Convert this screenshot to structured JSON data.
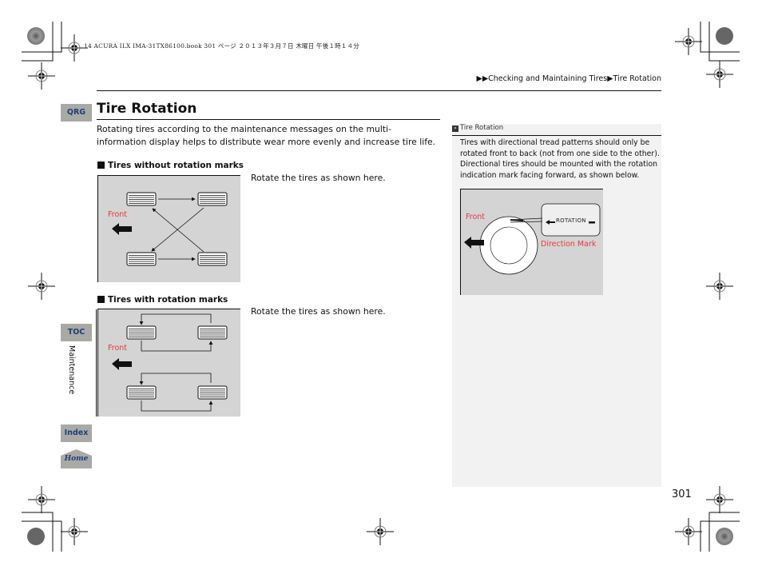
{
  "print_header": "14 ACURA ILX IMA-31TX86100.book  301 ページ  ２０１３年３月７日  木曜日  午後１時１４分",
  "breadcrumb": {
    "prefix_icon": "double-triangle-right-icon",
    "items": [
      "Checking and Maintaining Tires",
      "Tire Rotation"
    ],
    "separator_icon": "triangle-right-icon"
  },
  "nav": {
    "qrg": "QRG",
    "toc": "TOC",
    "index": "Index",
    "home": "Home",
    "section_label": "Maintenance"
  },
  "main": {
    "title": "Tire Rotation",
    "intro": "Rotating tires according to the maintenance messages on the multi-information display helps to distribute wear more evenly and increase tire life.",
    "sections": [
      {
        "heading": "Tires without rotation marks",
        "instruction": "Rotate the tires as shown here.",
        "figure": {
          "front_label": "Front",
          "pattern": "cross"
        }
      },
      {
        "heading": "Tires with rotation marks",
        "instruction": "Rotate the tires as shown here.",
        "figure": {
          "front_label": "Front",
          "pattern": "front-to-back"
        }
      }
    ]
  },
  "side_note": {
    "heading": "Tire Rotation",
    "text": "Tires with directional tread patterns should only be rotated front to back (not from one side to the other). Directional tires should be mounted with the rotation indication mark facing forward, as shown below.",
    "figure": {
      "front_label": "Front",
      "mark_text": "ROTATION",
      "mark_label": "Direction Mark"
    }
  },
  "page_number": "301",
  "colors": {
    "accent_red": "#e8383d",
    "nav_button_bg": "#a9aaa6",
    "nav_button_text": "#1f3d7a",
    "figure_bg": "#d4d4d4",
    "side_panel_bg": "#f2f2f2"
  }
}
